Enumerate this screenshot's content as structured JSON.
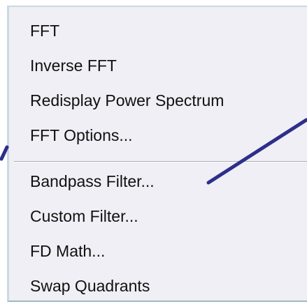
{
  "menu": {
    "items": [
      {
        "label": "FFT"
      },
      {
        "label": "Inverse FFT"
      },
      {
        "label": "Redisplay Power Spectrum"
      },
      {
        "label": "FFT Options..."
      },
      {
        "label": "Bandpass Filter..."
      },
      {
        "label": "Custom Filter..."
      },
      {
        "label": "FD Math..."
      },
      {
        "label": "Swap Quadrants"
      }
    ]
  },
  "colors": {
    "menu_background": "#efeff5",
    "annotation_arrow": "#2e2e8a"
  }
}
